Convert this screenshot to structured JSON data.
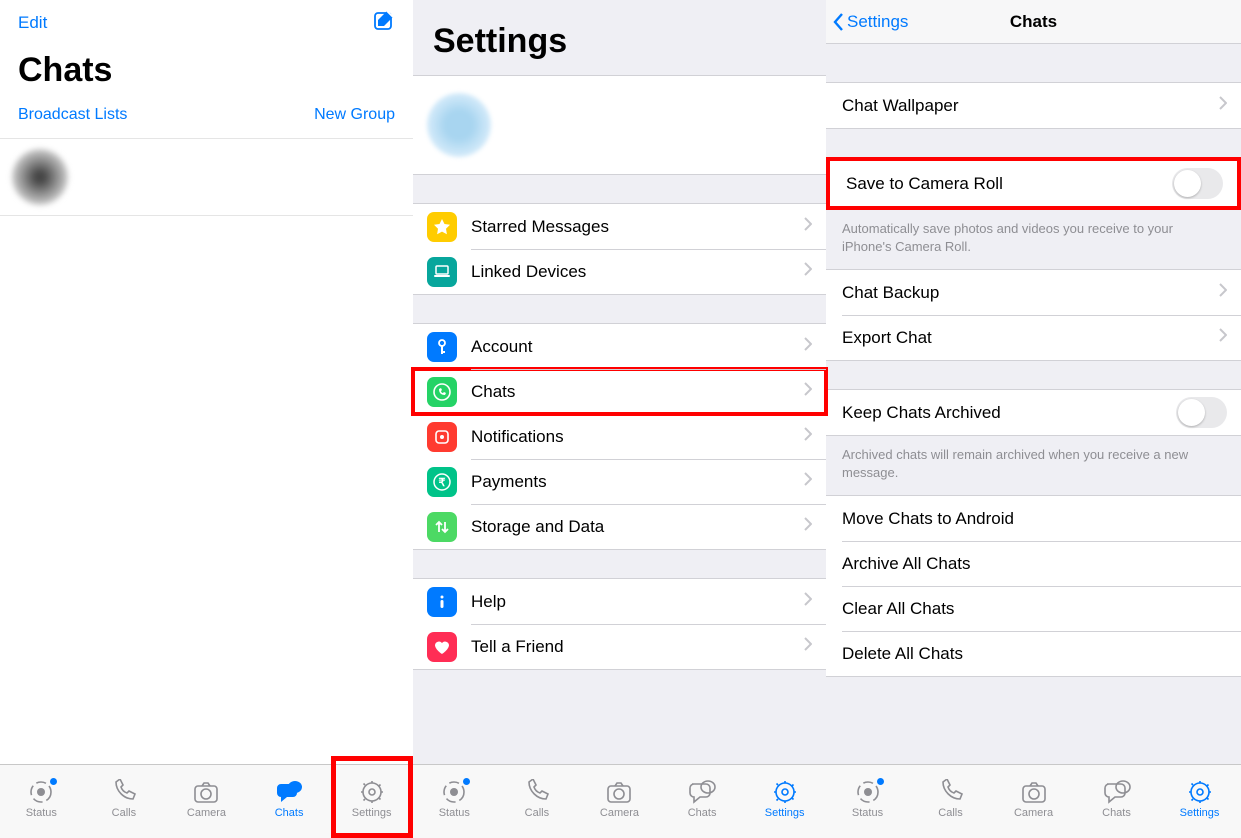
{
  "pane1": {
    "edit": "Edit",
    "title": "Chats",
    "broadcast": "Broadcast Lists",
    "newgroup": "New Group"
  },
  "pane2": {
    "title": "Settings",
    "rows": {
      "starred": "Starred Messages",
      "linked": "Linked Devices",
      "account": "Account",
      "chats": "Chats",
      "notifications": "Notifications",
      "payments": "Payments",
      "storage": "Storage and Data",
      "help": "Help",
      "tell": "Tell a Friend"
    }
  },
  "pane3": {
    "back": "Settings",
    "title": "Chats",
    "wallpaper": "Chat Wallpaper",
    "savecr": "Save to Camera Roll",
    "savecr_note": "Automatically save photos and videos you receive to your iPhone's Camera Roll.",
    "backup": "Chat Backup",
    "export": "Export Chat",
    "keeparch": "Keep Chats Archived",
    "keeparch_note": "Archived chats will remain archived when you receive a new message.",
    "move": "Move Chats to Android",
    "archive": "Archive All Chats",
    "clear": "Clear All Chats",
    "delete": "Delete All Chats"
  },
  "tabs": {
    "status": "Status",
    "calls": "Calls",
    "camera": "Camera",
    "chats": "Chats",
    "settings": "Settings"
  }
}
